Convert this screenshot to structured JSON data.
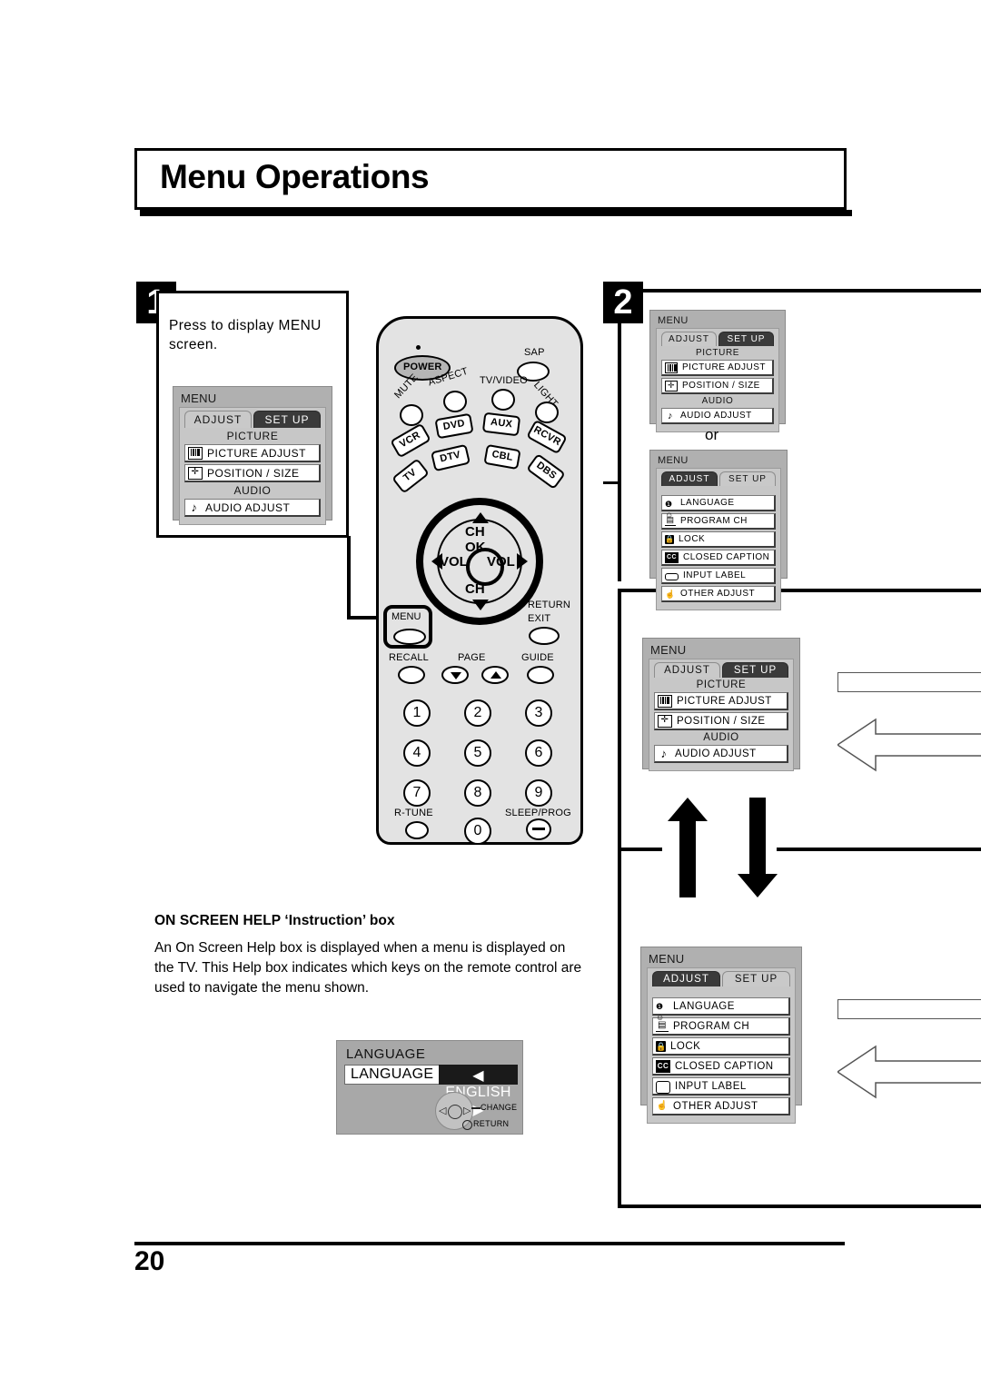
{
  "page": {
    "title": "Menu Operations",
    "number": "20"
  },
  "steps": [
    {
      "badge": "1",
      "instruction": "Press to display MENU screen."
    },
    {
      "badge": "2",
      "separator_label": "or"
    }
  ],
  "osd_menus": {
    "adjust": {
      "title": "MENU",
      "tabs": [
        {
          "label": "ADJUST",
          "selected": true
        },
        {
          "label": "SET UP",
          "selected": false
        }
      ],
      "sections": [
        {
          "heading": "PICTURE",
          "items": [
            {
              "icon": "picture-bars-icon",
              "label": "PICTURE  ADJUST"
            },
            {
              "icon": "move-arrows-icon",
              "label": "POSITION / SIZE"
            }
          ]
        },
        {
          "heading": "AUDIO",
          "items": [
            {
              "icon": "music-note-icon",
              "label": "AUDIO  ADJUST"
            }
          ]
        }
      ]
    },
    "setup": {
      "title": "MENU",
      "tabs": [
        {
          "label": "ADJUST",
          "selected": false
        },
        {
          "label": "SET UP",
          "selected": true
        }
      ],
      "sections": [
        {
          "heading": "",
          "items": [
            {
              "icon": "language-globe-icon",
              "label": "LANGUAGE"
            },
            {
              "icon": "program-ch-icon",
              "label": "PROGRAM CH"
            },
            {
              "icon": "lock-icon",
              "label": "LOCK"
            },
            {
              "icon": "closed-caption-icon",
              "label": "CLOSED  CAPTION"
            },
            {
              "icon": "input-label-icon",
              "label": "INPUT LABEL"
            },
            {
              "icon": "hand-pointer-icon",
              "label": "OTHER  ADJUST"
            }
          ]
        }
      ]
    }
  },
  "remote": {
    "power_label": "POWER",
    "top_labels": {
      "sap": "SAP",
      "aspect": "ASPECT",
      "tv_video": "TV/VIDEO",
      "light": "LIGHT",
      "mute": "MUTE"
    },
    "device_keys": [
      "VCR",
      "DVD",
      "AUX",
      "RCVR",
      "DTV",
      "CBL",
      "TV",
      "DBS"
    ],
    "nav": {
      "ch_up": "CH",
      "ok": "OK",
      "vol_left": "VOL",
      "vol_right": "VOL",
      "ch_down": "CH"
    },
    "menu_key": "MENU",
    "return_exit": "RETURN\nEXIT",
    "return_label": "RETURN",
    "exit_label": "EXIT",
    "recall_label": "RECALL",
    "page_label": "PAGE",
    "guide_label": "GUIDE",
    "numpad": [
      "1",
      "2",
      "3",
      "4",
      "5",
      "6",
      "7",
      "8",
      "9",
      "0"
    ],
    "r_tune_label": "R-TUNE",
    "sleep_prog_label": "SLEEP/PROG"
  },
  "help": {
    "heading": "ON SCREEN HELP ‘Instruction’ box",
    "body": "An On Screen Help box is displayed when a menu is displayed on the TV. This Help box indicates which keys on the remote control are used to navigate the menu shown."
  },
  "language_box": {
    "title": "LANGUAGE",
    "row_label": "LANGUAGE",
    "left_arrow": "◀",
    "value": "ENGLISH",
    "right_arrow": "▶",
    "change_label": "CHANGE",
    "return_label": "RETURN"
  }
}
